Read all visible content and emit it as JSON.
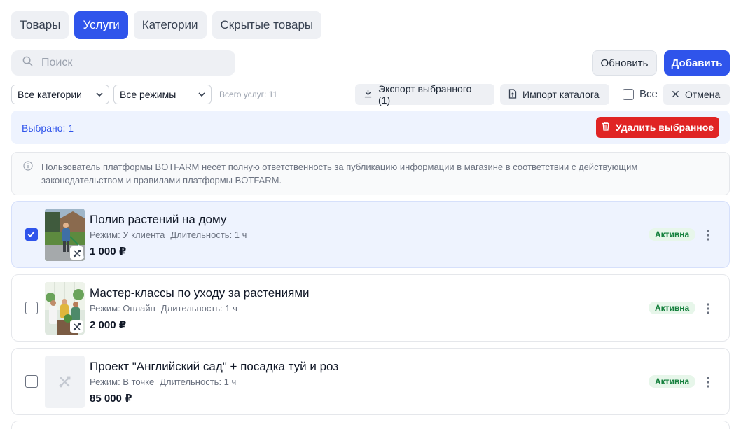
{
  "tabs": [
    {
      "label": "Товары",
      "active": false
    },
    {
      "label": "Услуги",
      "active": true
    },
    {
      "label": "Категории",
      "active": false
    },
    {
      "label": "Скрытые товары",
      "active": false
    }
  ],
  "search": {
    "placeholder": "Поиск",
    "icon": "search-icon"
  },
  "toolbar": {
    "refresh_label": "Обновить",
    "add_label": "Добавить"
  },
  "filters": {
    "category_selected": "Все категории",
    "mode_selected": "Все режимы",
    "total_text": "Всего услуг: 11"
  },
  "actions": {
    "export_label": "Экспорт выбранного (1)",
    "import_label": "Импорт каталога",
    "select_all_label": "Все",
    "cancel_label": "Отмена"
  },
  "selection": {
    "selected_text": "Выбрано: 1",
    "delete_label": "Удалить выбранное"
  },
  "notice": {
    "text": "Пользователь платформы BOTFARM несёт полную ответственность за публикацию информации в магазине в соответствии с действующим законодательством и правилами платформы BOTFARM."
  },
  "services": [
    {
      "title": "Полив растений на дому",
      "mode": "Режим: У клиента",
      "duration": "Длительность: 1 ч",
      "price": "1 000 ₽",
      "status": "Активна",
      "checked": true
    },
    {
      "title": "Мастер-классы по уходу за растениями",
      "mode": "Режим: Онлайн",
      "duration": "Длительность: 1 ч",
      "price": "2 000 ₽",
      "status": "Активна",
      "checked": false
    },
    {
      "title": "Проект \"Английский сад\" + посадка туй и роз",
      "mode": "Режим: В точке",
      "duration": "Длительность: 1 ч",
      "price": "85 000 ₽",
      "status": "Активна",
      "checked": false
    }
  ],
  "colors": {
    "accent": "#2f54eb",
    "danger": "#e02424",
    "status_active_bg": "#e7f6ea",
    "status_active_text": "#15803d"
  }
}
